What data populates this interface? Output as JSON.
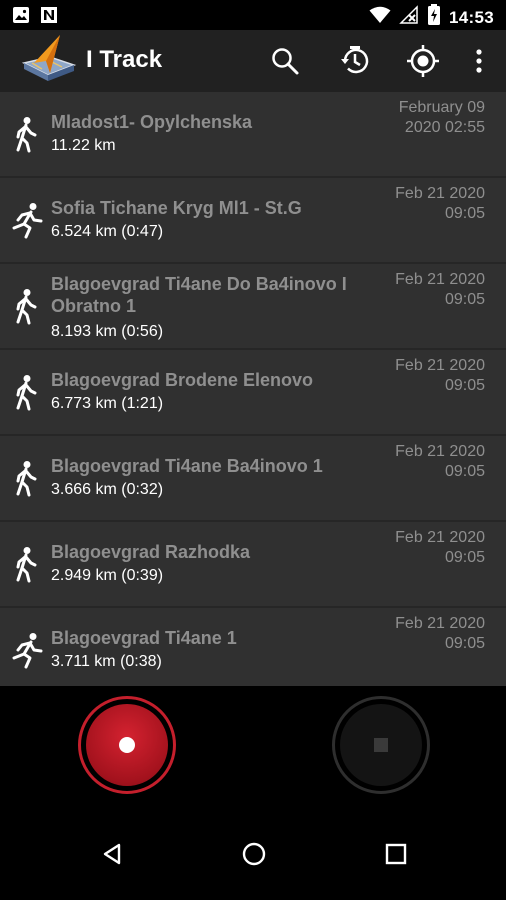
{
  "status_bar": {
    "time": "14:53",
    "left_icons": [
      "image-icon",
      "n-notification-icon"
    ],
    "right_icons": [
      "wifi-icon",
      "no-signal-icon",
      "battery-charging-icon"
    ]
  },
  "app_bar": {
    "title": "I Track",
    "actions": [
      "search-icon",
      "history-icon",
      "locate-icon",
      "more-vert-icon"
    ]
  },
  "tracks": [
    {
      "activity": "walk",
      "title": "Mladost1- Opylchenska",
      "distance": "11.22 km",
      "date_line1": "February 09",
      "date_line2": "2020 02:55"
    },
    {
      "activity": "run",
      "title": "Sofia Tichane Kryg Ml1 - St.G",
      "distance": "6.524 km (0:47)",
      "date_line1": "Feb 21 2020",
      "date_line2": "09:05"
    },
    {
      "activity": "walk",
      "title": "Blagoevgrad Ti4ane Do Ba4inovo I Obratno 1",
      "distance": "8.193 km (0:56)",
      "date_line1": "Feb 21 2020",
      "date_line2": "09:05"
    },
    {
      "activity": "walk",
      "title": "Blagoevgrad Brodene Elenovo",
      "distance": "6.773 km (1:21)",
      "date_line1": "Feb 21 2020",
      "date_line2": "09:05"
    },
    {
      "activity": "walk",
      "title": "Blagoevgrad Ti4ane Ba4inovo 1",
      "distance": "3.666 km (0:32)",
      "date_line1": "Feb 21 2020",
      "date_line2": "09:05"
    },
    {
      "activity": "walk",
      "title": "Blagoevgrad Razhodka",
      "distance": "2.949 km (0:39)",
      "date_line1": "Feb 21 2020",
      "date_line2": "09:05"
    },
    {
      "activity": "run",
      "title": "Blagoevgrad Ti4ane 1",
      "distance": "3.711 km (0:38)",
      "date_line1": "Feb 21 2020",
      "date_line2": "09:05"
    }
  ],
  "controls": {
    "record_icon": "record-icon",
    "stop_icon": "stop-icon",
    "record_color": "#c41f2c"
  },
  "nav_bar": [
    "back-icon",
    "home-icon",
    "recents-icon"
  ]
}
